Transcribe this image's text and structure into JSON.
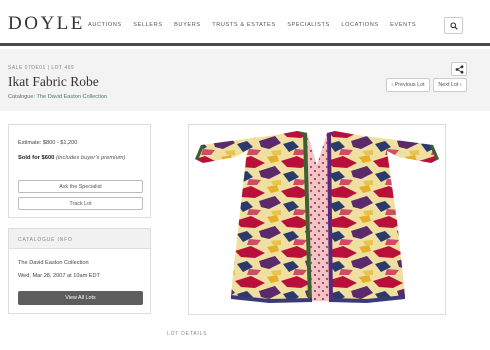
{
  "header": {
    "logo": "DOYLE",
    "nav": [
      "AUCTIONS",
      "SELLERS",
      "BUYERS",
      "TRUSTS & ESTATES",
      "SPECIALISTS",
      "LOCATIONS",
      "EVENTS"
    ]
  },
  "lot": {
    "sale_line": "SALE 07DE01  |  LOT 469",
    "title": "Ikat Fabric Robe",
    "catalogue_prefix": "Catalogue:",
    "catalogue_name": "The David Easton Collection",
    "prev_label": "‹ Previous Lot",
    "next_label": "Next Lot ›"
  },
  "pricing": {
    "estimate": "Estimate: $800 - $1,200",
    "sold_bold": "Sold for $600",
    "sold_note": "(includes buyer's premium)",
    "ask_label": "Ask the Specialist",
    "track_label": "Track Lot"
  },
  "catalogue_info": {
    "heading": "CATALOGUE INFO",
    "name": "The David Easton Collection",
    "date": "Wed, Mar 28, 2007 at 10am EDT",
    "view_all_label": "View All Lots"
  },
  "lot_details_heading": "LOT DETAILS",
  "colors": {
    "accent_link": "#4a7a6a",
    "dark_button": "#5d5d5d",
    "band_bg": "#f3f3f3"
  }
}
